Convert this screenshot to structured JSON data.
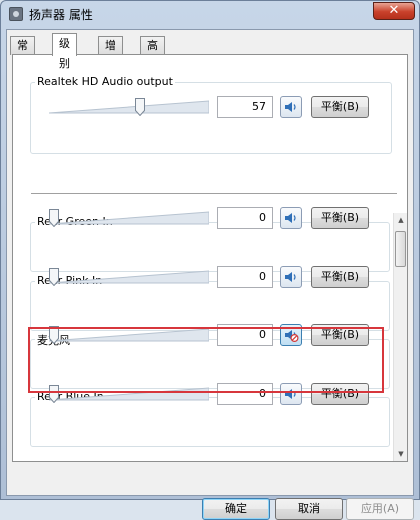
{
  "window": {
    "title": "扬声器 属性",
    "close_glyph": "✕"
  },
  "tabs": [
    {
      "label": "常规",
      "active": false
    },
    {
      "label": "级别",
      "active": true
    },
    {
      "label": "增强",
      "active": false
    },
    {
      "label": "高级",
      "active": false
    }
  ],
  "master": {
    "name": "Realtek HD Audio output",
    "value": "57",
    "balance_label": "平衡(B)",
    "muted": false
  },
  "channels": [
    {
      "name": "Rear Green In",
      "value": "0",
      "balance_label": "平衡(B)",
      "muted": false
    },
    {
      "name": "Rear Pink In",
      "value": "0",
      "balance_label": "平衡(B)",
      "muted": false
    },
    {
      "name": "麦克风",
      "value": "0",
      "balance_label": "平衡(B)",
      "muted": true
    },
    {
      "name": "Rear Blue In",
      "value": "0",
      "balance_label": "平衡(B)",
      "muted": false
    }
  ],
  "footer": {
    "ok_label": "确定",
    "cancel_label": "取消",
    "apply_label": "应用(A)"
  },
  "colors": {
    "highlight": "#d7363c",
    "speaker_icon": "#2f6fb7",
    "mute_slash": "#d23b3b"
  },
  "icons": {
    "speaker": "speaker-icon",
    "muted_speaker": "speaker-muted-icon",
    "scroll_up": "scroll-up-arrow",
    "scroll_down": "scroll-down-arrow"
  }
}
